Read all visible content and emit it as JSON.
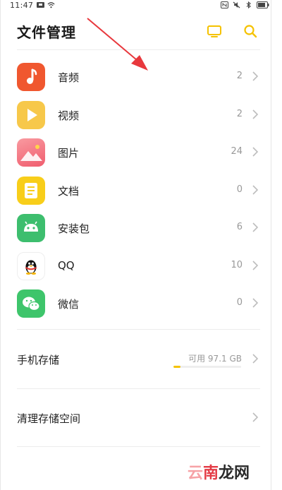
{
  "status_bar": {
    "time": "11:47"
  },
  "header": {
    "title": "文件管理",
    "accent_color": "#f5c200"
  },
  "categories": [
    {
      "label": "音频",
      "count": "2",
      "icon": "music-note-icon",
      "color": "#f0572f"
    },
    {
      "label": "视频",
      "count": "2",
      "icon": "play-icon",
      "color": "#f7c84a"
    },
    {
      "label": "图片",
      "count": "24",
      "icon": "picture-icon",
      "color": "#f36b7a"
    },
    {
      "label": "文档",
      "count": "0",
      "icon": "document-icon",
      "color": "#f8ce1a"
    },
    {
      "label": "安装包",
      "count": "6",
      "icon": "android-icon",
      "color": "#3dbe6e"
    },
    {
      "label": "QQ",
      "count": "10",
      "icon": "qq-penguin-icon",
      "color": "#ffffff"
    },
    {
      "label": "微信",
      "count": "0",
      "icon": "wechat-icon",
      "color": "#3ec56b"
    }
  ],
  "storage": {
    "label": "手机存储",
    "available": "可用 97.1 GB",
    "used_fraction": 0.1
  },
  "clean": {
    "label": "清理存储空间"
  },
  "watermark": {
    "part1": "云",
    "part2": "南",
    "part3": "龙网"
  }
}
